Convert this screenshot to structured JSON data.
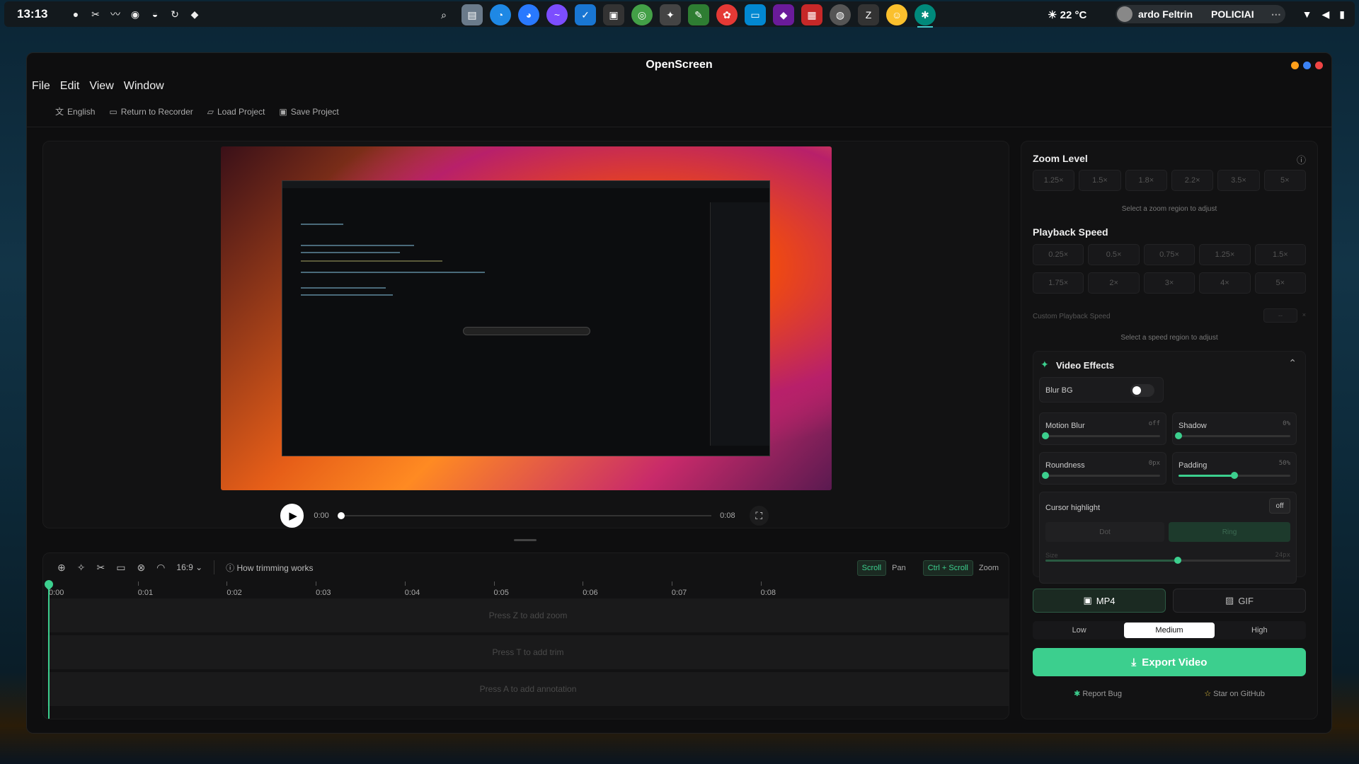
{
  "taskbar": {
    "clock": "13:13",
    "weather": "☀ 22 °C",
    "user_label": "ardo Feltrin",
    "user_org": "POLICIAI",
    "user_more": "⋯"
  },
  "window": {
    "title": "OpenScreen",
    "menu": [
      "File",
      "Edit",
      "View",
      "Window"
    ],
    "toolbar": {
      "language": "English",
      "return_to_recorder": "Return to Recorder",
      "load_project": "Load Project",
      "save_project": "Save Project"
    }
  },
  "player": {
    "current_time": "0:00",
    "duration": "0:08",
    "progress": 0
  },
  "timeline": {
    "aspect_ratio": "16:9",
    "help_label": "How trimming works",
    "shortcuts": [
      {
        "key": "Scroll",
        "action": "Pan"
      },
      {
        "key": "Ctrl + Scroll",
        "action": "Zoom"
      }
    ],
    "ticks": [
      "0:00",
      "0:01",
      "0:02",
      "0:03",
      "0:04",
      "0:05",
      "0:06",
      "0:07",
      "0:08"
    ],
    "lanes": [
      "Press Z to add zoom",
      "Press T to add trim",
      "Press A to add annotation"
    ]
  },
  "sidebar": {
    "zoom": {
      "title": "Zoom Level",
      "levels": [
        "1.25×",
        "1.5×",
        "1.8×",
        "2.2×",
        "3.5×",
        "5×"
      ],
      "hint": "Select a zoom region to adjust"
    },
    "speed": {
      "title": "Playback Speed",
      "row1": [
        "0.25×",
        "0.5×",
        "0.75×",
        "1.25×",
        "1.5×"
      ],
      "row2": [
        "1.75×",
        "2×",
        "3×",
        "4×",
        "5×"
      ],
      "custom_label": "Custom Playback Speed",
      "custom_value": "--",
      "custom_unit": "×",
      "hint": "Select a speed region to adjust"
    },
    "effects": {
      "title": "Video Effects",
      "blur_bg": "Blur BG",
      "motion_blur": {
        "label": "Motion Blur",
        "value": "off",
        "level": 0
      },
      "shadow": {
        "label": "Shadow",
        "value": "0%",
        "level": 0
      },
      "roundness": {
        "label": "Roundness",
        "value": "0px",
        "level": 0
      },
      "padding": {
        "label": "Padding",
        "value": "50%",
        "level": 0.5
      },
      "cursor_highlight": {
        "label": "Cursor highlight",
        "toggle": "off",
        "modes": [
          "Dot",
          "Ring"
        ]
      },
      "size": {
        "label": "Size",
        "value": "24px",
        "level": 0.54
      }
    },
    "export": {
      "formats": [
        "MP4",
        "GIF"
      ],
      "quality": [
        "Low",
        "Medium",
        "High"
      ],
      "selected_quality": "Medium",
      "button": "Export Video",
      "report_bug": "Report Bug",
      "star": "Star on GitHub"
    }
  }
}
